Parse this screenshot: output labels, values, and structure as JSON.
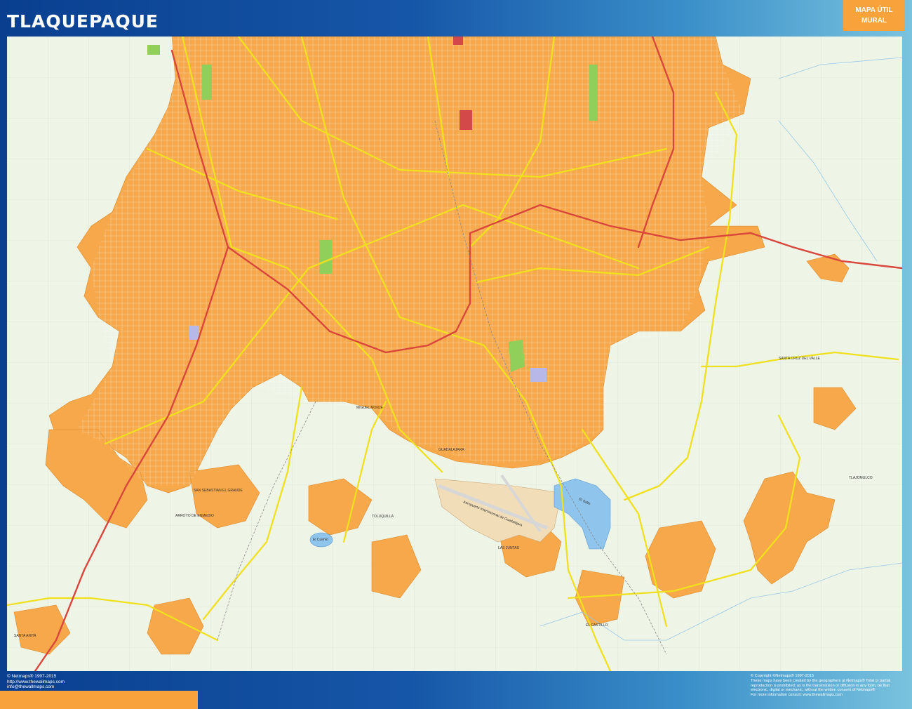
{
  "header": {
    "title": "TLAQUEPAQUE",
    "badge_line1": "MAPA ÚTIL",
    "badge_line2": "MURAL"
  },
  "map": {
    "labels": {
      "lake_main": "El Salto",
      "lake_small": "El Cuervo",
      "city": "GUADALAJARA",
      "airport": "Aeropuerto Internacional de Guadalajara",
      "place_a": "MIGUEL MONJE",
      "place_b": "SAN SEBASTIAN EL GRANDE",
      "place_c": "ARROYO DE ENMEDIO",
      "place_d": "SANTA CRUZ DEL VALLE",
      "place_e": "TOLUQUILLA",
      "place_f": "EL CASTILLO",
      "place_g": "SANTA ANITA",
      "place_h": "LAS JUNTAS",
      "place_i": "TLAJOMULCO"
    },
    "colors": {
      "background": "#eef4e6",
      "urban": "#f6a84a",
      "road_major": "#f0e01e",
      "highway": "#d9463b",
      "water": "#8fc4ec",
      "park": "#8fcf5a"
    }
  },
  "footer": {
    "left": {
      "line1": "© Netmaps® 1997-2015",
      "line2": "http://www.thewallmaps.com",
      "line3": "info@thewallmaps.com"
    },
    "right": {
      "line1": "© Copyright ©Netmaps® 1997-2015",
      "line2": "These maps have been created by the geographers at Netmaps® Total or partial",
      "line3": "reproduction is prohibited; as is the transmission or diffusion in any form, be that",
      "line4": "electronic, digital or mechanic; without the written consent of Netmaps®",
      "line5": "For more information consult: www.thewallmaps.com"
    }
  }
}
